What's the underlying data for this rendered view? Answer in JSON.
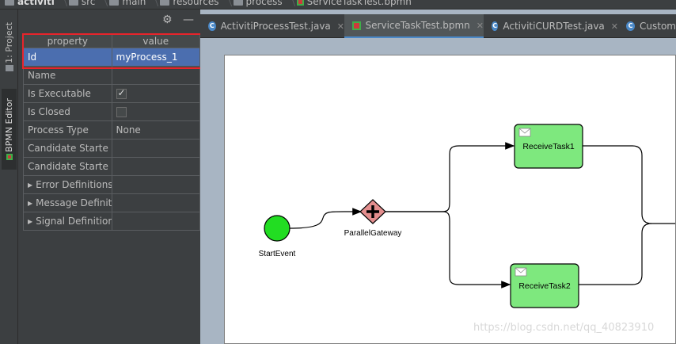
{
  "breadcrumb": {
    "items": [
      "activiti",
      "src",
      "main",
      "resources",
      "process",
      "ServiceTaskTest.bpmn"
    ]
  },
  "left_strip": {
    "project_tab": "1: Project",
    "bpmn_tab": "BPMN Editor"
  },
  "properties": {
    "header_property": "property",
    "header_value": "value",
    "rows": [
      {
        "name": "Id",
        "value": "myProcess_1"
      },
      {
        "name": "Name",
        "value": ""
      },
      {
        "name": "Is Executable",
        "value": ""
      },
      {
        "name": "Is Closed",
        "value": ""
      },
      {
        "name": "Process Type",
        "value": "None"
      },
      {
        "name": "Candidate Starte",
        "value": ""
      },
      {
        "name": "Candidate Starte",
        "value": ""
      },
      {
        "name": "Error Definitions",
        "value": ""
      },
      {
        "name": "Message Definiti",
        "value": ""
      },
      {
        "name": "Signal Definitions",
        "value": ""
      }
    ],
    "is_executable_checked": true,
    "is_closed_checked": false
  },
  "tabs": [
    {
      "label": "ActivitiProcessTest.java",
      "icon": "java-class-icon"
    },
    {
      "label": "ServiceTaskTest.bpmn",
      "icon": "bpmn-file-icon",
      "active": true
    },
    {
      "label": "ActivitiCURDTest.java",
      "icon": "java-class-icon"
    },
    {
      "label": "Custom",
      "icon": "java-class-icon"
    }
  ],
  "diagram": {
    "start_event": "StartEvent",
    "gateway": "ParallelGateway",
    "task1": "ReceiveTask1",
    "task2": "ReceiveTask2"
  },
  "watermark": "https://blog.csdn.net/qq_40823910",
  "colors": {
    "selection": "#4b6eaf",
    "highlight": "#e8242b",
    "task_fill": "#7ee87e",
    "start_fill": "#22dd22",
    "gateway_fill": "#e38e8e"
  }
}
